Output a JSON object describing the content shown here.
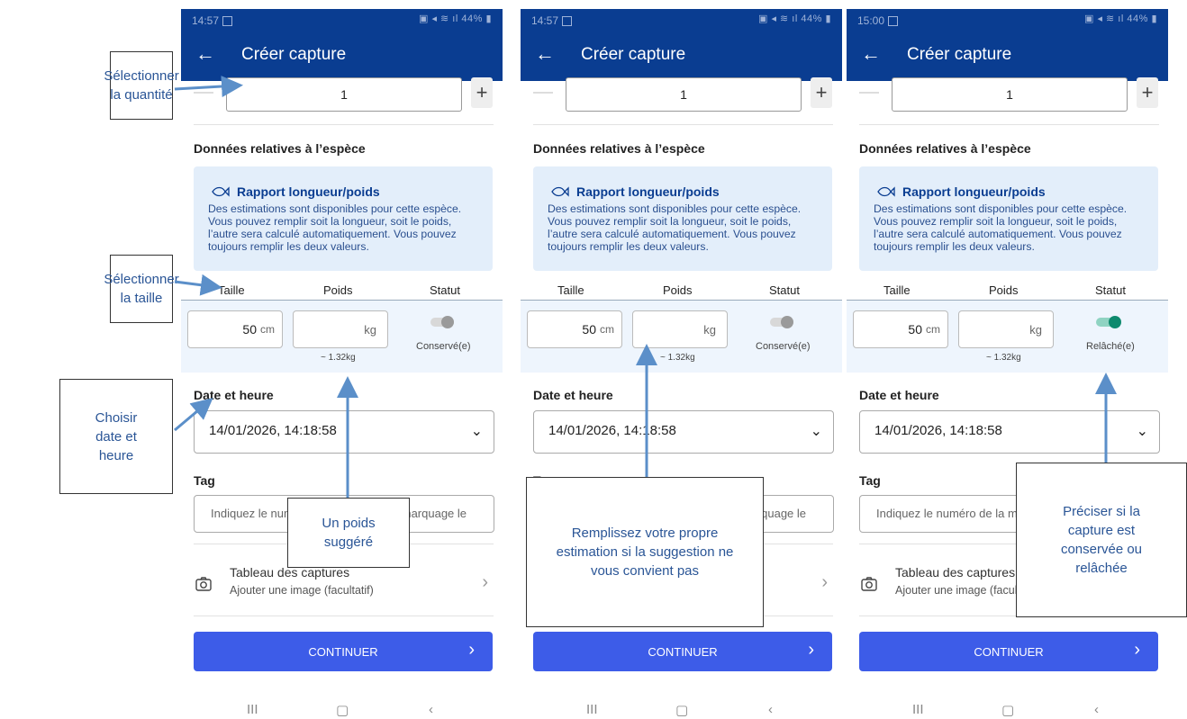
{
  "app": {
    "title": "Créer capture"
  },
  "screens": [
    {
      "time": "14:57",
      "battery": "44%",
      "qty": "1",
      "length": "50",
      "status_label": "Conservé(e)"
    },
    {
      "time": "14:57",
      "battery": "44%",
      "qty": "1",
      "length": "50",
      "status_label": "Conservé(e)"
    },
    {
      "time": "15:00",
      "battery": "44%",
      "qty": "1",
      "length": "50",
      "status_label": "Relâché(e)"
    }
  ],
  "form": {
    "section_title": "Données relatives à l’espèce",
    "info_title": "Rapport longueur/poids",
    "info_text": "Des estimations sont disponibles pour cette espèce. Vous pouvez remplir soit la longueur, soit le poids, l’autre sera calculé automatiquement. Vous pouvez toujours remplir les deux valeurs.",
    "col_size": "Taille",
    "col_weight": "Poids",
    "col_status": "Statut",
    "unit_cm": "cm",
    "unit_kg": "kg",
    "weight_hint": "~ 1.32kg",
    "datetime_label": "Date et heure",
    "datetime_value": "14/01/2026, 14:18:58",
    "tag_label": "Tag",
    "tag_placeholder": "Indiquez le numéro de la marque de marquage le",
    "capture_title": "Tableau des captures",
    "capture_sub": "Ajouter une image (facultatif)",
    "continue": "CONTINUER"
  },
  "callouts": {
    "quantity": "Sélectionner la quantité",
    "size": "Sélectionner la taille",
    "datetime": "Choisir date et heure",
    "weight": "Un poids suggéré",
    "estimate": "Remplissez votre propre estimation si la suggestion ne vous convient pas",
    "status": "Préciser si la capture est conservée ou relâchée"
  },
  "icons": [
    "back-arrow-icon",
    "fish-icon",
    "chevron-down-icon",
    "camera-icon",
    "chevron-right-icon",
    "recents-icon",
    "home-icon",
    "back-nav-icon"
  ],
  "colors": {
    "appbar": "#0a3d91",
    "button": "#3d5ce8",
    "info_bg": "#e3eefa",
    "toggle_on": "#0e8a6e",
    "callout_text": "#2a5596",
    "arrow": "#5b8fc9"
  }
}
